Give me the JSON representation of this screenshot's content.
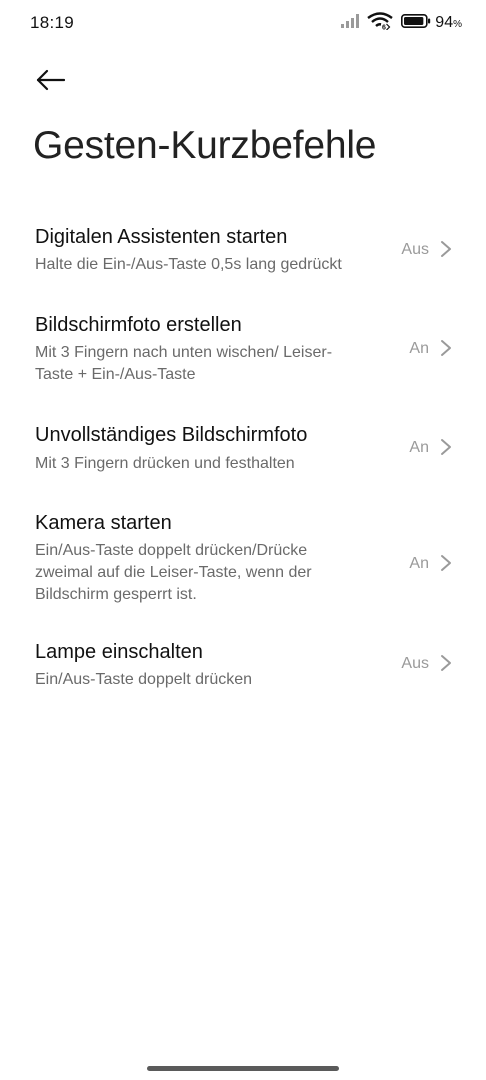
{
  "status_bar": {
    "time": "18:19",
    "battery_percent": "94",
    "battery_sign": "%",
    "battery_level": 0.94
  },
  "header": {
    "title": "Gesten-Kurzbefehle"
  },
  "items": [
    {
      "title": "Digitalen Assistenten starten",
      "subtitle": "Halte die Ein-/Aus-Taste 0,5s lang gedrückt",
      "value": "Aus"
    },
    {
      "title": "Bildschirmfoto erstellen",
      "subtitle": "Mit 3 Fingern nach unten wischen/ Leiser-Taste + Ein-/Aus-Taste",
      "value": "An"
    },
    {
      "title": "Unvollständiges Bildschirmfoto",
      "subtitle": "Mit 3 Fingern drücken und festhalten",
      "value": "An"
    },
    {
      "title": "Kamera starten",
      "subtitle": "Ein/Aus-Taste doppelt drücken/Drücke zweimal auf die Leiser-Taste, wenn der Bildschirm gesperrt ist.",
      "value": "An"
    },
    {
      "title": "Lampe einschalten",
      "subtitle": "Ein/Aus-Taste doppelt drücken",
      "value": "Aus"
    }
  ]
}
